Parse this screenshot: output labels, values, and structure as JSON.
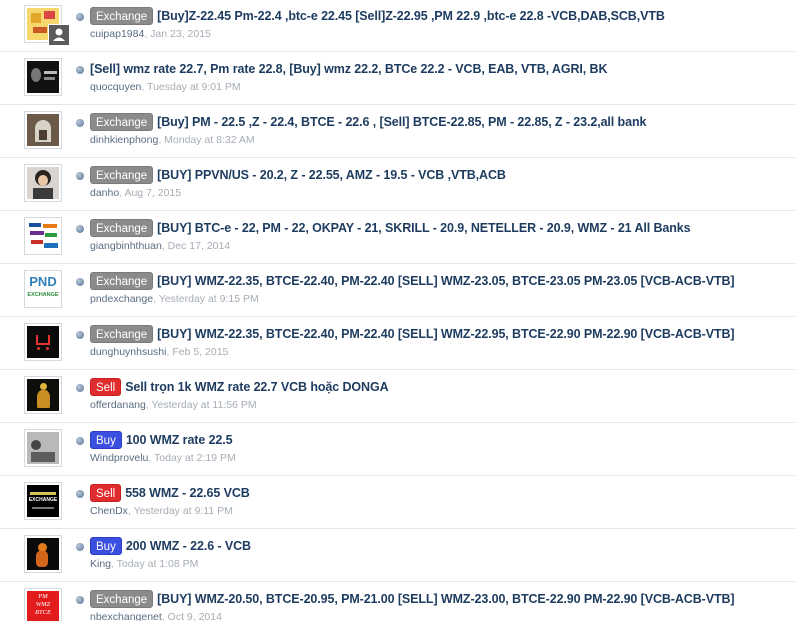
{
  "threads": [
    {
      "prefix": "Exchange",
      "prefix_type": "exchange",
      "title": "[Buy]Z-22.45 Pm-22.4 ,btc-e 22.45 [Sell]Z-22.95 ,PM 22.9 ,btc-e 22.8 -VCB,DAB,SCB,VTB",
      "author": "cuipap1984",
      "date": "Jan 23, 2015",
      "avatar": "yellow-grid",
      "has_secondary": true
    },
    {
      "prefix": "",
      "prefix_type": "none",
      "title": "[Sell] wmz rate 22.7, Pm rate 22.8, [Buy] wmz 22.2, BTCe 22.2 - VCB, EAB, VTB, AGRI, BK",
      "author": "quocquyen",
      "date": "Tuesday at 9:01 PM",
      "avatar": "dark-portrait"
    },
    {
      "prefix": "Exchange",
      "prefix_type": "exchange",
      "title": "[Buy] PM - 22.5 ,Z - 22.4, BTCE - 22.6 , [Sell] BTCE-22.85, PM - 22.85, Z - 23.2,all bank",
      "author": "dinhkienphong",
      "date": "Monday at 8:32 AM",
      "avatar": "arch-window"
    },
    {
      "prefix": "Exchange",
      "prefix_type": "exchange",
      "title": "[BUY] PPVN/US - 20.2, Z - 22.55, AMZ - 19.5 - VCB ,VTB,ACB",
      "author": "danho",
      "date": "Aug 7, 2015",
      "avatar": "person-portrait"
    },
    {
      "prefix": "Exchange",
      "prefix_type": "exchange",
      "title": "[BUY] BTC-e - 22, PM - 22, OKPAY - 21, SKRILL - 20.9, NETELLER - 20.9, WMZ - 21 All Banks",
      "author": "giangbinhthuan",
      "date": "Dec 17, 2014",
      "avatar": "payment-logos"
    },
    {
      "prefix": "Exchange",
      "prefix_type": "exchange",
      "title": "[BUY] WMZ-22.35, BTCE-22.40, PM-22.40 [SELL] WMZ-23.05, BTCE-23.05 PM-23.05 [VCB-ACB-VTB]",
      "author": "pndexchange",
      "date": "Yesterday at 9:15 PM",
      "avatar": "pnd-logo",
      "avatar_text_1": "PND",
      "avatar_text_2": "EXCHANGE"
    },
    {
      "prefix": "Exchange",
      "prefix_type": "exchange",
      "title": "[BUY] WMZ-22.35, BTCE-22.40, PM-22.40 [SELL] WMZ-22.95, BTCE-22.90 PM-22.90 [VCB-ACB-VTB]",
      "author": "dunghuynhsushi",
      "date": "Feb 5, 2015",
      "avatar": "cart-logo"
    },
    {
      "prefix": "Sell",
      "prefix_type": "sell",
      "title": "Sell trọn 1k WMZ rate 22.7 VCB hoặc DONGA",
      "author": "offerdanang",
      "date": "Yesterday at 11:56 PM",
      "avatar": "golden-statue"
    },
    {
      "prefix": "Buy",
      "prefix_type": "buy",
      "title": "100 WMZ rate 22.5",
      "author": "Windprovelu",
      "date": "Today at 2:19 PM",
      "avatar": "bw-photo"
    },
    {
      "prefix": "Sell",
      "prefix_type": "sell",
      "title": "558 WMZ - 22.65 VCB",
      "author": "ChenDx",
      "date": "Yesterday at 9:11 PM",
      "avatar": "exchange-banner",
      "avatar_text_2": "EXCHANGE"
    },
    {
      "prefix": "Buy",
      "prefix_type": "buy",
      "title": "200 WMZ - 22.6 - VCB",
      "author": "King",
      "date": "Today at 1:08 PM",
      "avatar": "orange-figure"
    },
    {
      "prefix": "Exchange",
      "prefix_type": "exchange",
      "title": "[BUY] WMZ-20.50, BTCE-20.95, PM-21.00 [SELL] WMZ-23.00, BTCE-22.90 PM-22.90 [VCB-ACB-VTB]",
      "author": "nbexchangenet",
      "date": "Oct 9, 2014",
      "avatar": "red-pm-logo",
      "avatar_text_1": "PM",
      "avatar_text_2": "WMZ",
      "avatar_text_3": "BTCE"
    }
  ],
  "separator": ",",
  "colors": {
    "title": "#1d3b5f",
    "author": "#5a6d82",
    "date": "#a6adb5",
    "exchange": "#8b8b8b",
    "sell": "#e02c2c",
    "buy": "#3b4fe0"
  }
}
